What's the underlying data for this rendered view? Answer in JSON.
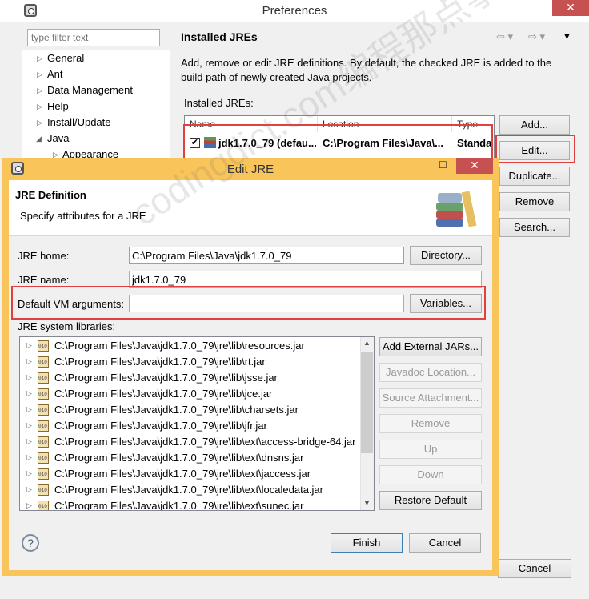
{
  "preferences": {
    "title": "Preferences",
    "filter_placeholder": "type filter text",
    "tree": [
      "General",
      "Ant",
      "Data Management",
      "Help",
      "Install/Update",
      "Java",
      "Appearance"
    ],
    "heading": "Installed JREs",
    "description": "Add, remove or edit JRE definitions. By default, the checked JRE is added to the build path of newly created Java projects.",
    "installed_label": "Installed JREs:",
    "columns": [
      "Name",
      "Location",
      "Type"
    ],
    "row": {
      "name": "jdk1.7.0_79 (defau...",
      "location": "C:\\Program Files\\Java\\...",
      "type": "Standa",
      "checked": true
    },
    "buttons": {
      "add": "Add...",
      "edit": "Edit...",
      "duplicate": "Duplicate...",
      "remove": "Remove",
      "search": "Search...",
      "cancel": "Cancel"
    },
    "close_glyph": "✕"
  },
  "dialog": {
    "title": "Edit JRE",
    "header_title": "JRE Definition",
    "header_sub": "Specify attributes for a JRE",
    "jre_home_label": "JRE home:",
    "jre_home_value": "C:\\Program Files\\Java\\jdk1.7.0_79",
    "jre_name_label": "JRE name:",
    "jre_name_value": "jdk1.7.0_79",
    "vm_args_label": "Default VM arguments:",
    "vm_args_value": "",
    "directory_btn": "Directory...",
    "variables_btn": "Variables...",
    "libs_label": "JRE system libraries:",
    "libraries": [
      "C:\\Program Files\\Java\\jdk1.7.0_79\\jre\\lib\\resources.jar",
      "C:\\Program Files\\Java\\jdk1.7.0_79\\jre\\lib\\rt.jar",
      "C:\\Program Files\\Java\\jdk1.7.0_79\\jre\\lib\\jsse.jar",
      "C:\\Program Files\\Java\\jdk1.7.0_79\\jre\\lib\\jce.jar",
      "C:\\Program Files\\Java\\jdk1.7.0_79\\jre\\lib\\charsets.jar",
      "C:\\Program Files\\Java\\jdk1.7.0_79\\jre\\lib\\jfr.jar",
      "C:\\Program Files\\Java\\jdk1.7.0_79\\jre\\lib\\ext\\access-bridge-64.jar",
      "C:\\Program Files\\Java\\jdk1.7.0_79\\jre\\lib\\ext\\dnsns.jar",
      "C:\\Program Files\\Java\\jdk1.7.0_79\\jre\\lib\\ext\\jaccess.jar",
      "C:\\Program Files\\Java\\jdk1.7.0_79\\jre\\lib\\ext\\localedata.jar",
      "C:\\Program Files\\Java\\jdk1.7.0_79\\jre\\lib\\ext\\sunec.jar"
    ],
    "side_buttons": {
      "add_external": "Add External JARs...",
      "javadoc": "Javadoc Location...",
      "source": "Source Attachment...",
      "remove": "Remove",
      "up": "Up",
      "down": "Down",
      "restore": "Restore Default"
    },
    "finish": "Finish",
    "cancel": "Cancel",
    "help_glyph": "?",
    "close_glyph": "✕",
    "min_glyph": "–",
    "max_glyph": "☐"
  },
  "watermark": "codingdict.com编程那点事",
  "colors": {
    "dialog_frame": "#f9c45a",
    "highlight": "#e04040",
    "close": "#c75050"
  }
}
